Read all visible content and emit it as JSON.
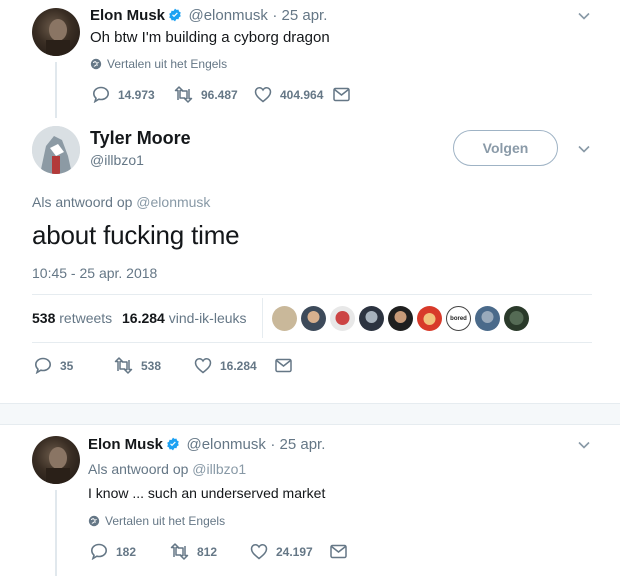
{
  "tweet1": {
    "name": "Elon Musk",
    "handle": "@elonmusk",
    "date": "· 25 apr.",
    "text": "Oh btw I'm building a cyborg dragon",
    "translate": "Vertalen uit het Engels",
    "replies": "14.973",
    "retweets": "96.487",
    "likes": "404.964"
  },
  "main_tweet": {
    "name": "Tyler Moore",
    "handle": "@illbzo1",
    "follow_label": "Volgen",
    "reply_prefix": "Als antwoord op",
    "reply_to": "@elonmusk",
    "text": "about fucking time",
    "timestamp": "10:45 - 25 apr. 2018",
    "retweet_count": "538",
    "retweet_label": "retweets",
    "like_count": "16.284",
    "like_label": "vind-ik-leuks",
    "liker_badge_text": "bored",
    "replies": "35",
    "retweets": "538",
    "likes": "16.284"
  },
  "tweet3": {
    "name": "Elon Musk",
    "handle": "@elonmusk",
    "date": "· 25 apr.",
    "reply_prefix": "Als antwoord op",
    "reply_to": "@illbzo1",
    "text": "I know ... such an underserved market",
    "translate": "Vertalen uit het Engels",
    "replies": "182",
    "retweets": "812",
    "likes": "24.197"
  },
  "colors": {
    "verified_blue": "#1da1f2",
    "muted_gray": "#657786",
    "divider": "#e6ecf0",
    "follow_border": "#9fb3c5"
  },
  "icons": [
    "verified-badge-icon",
    "chevron-down-icon",
    "globe-icon",
    "reply-icon",
    "retweet-icon",
    "heart-icon",
    "mail-icon"
  ]
}
